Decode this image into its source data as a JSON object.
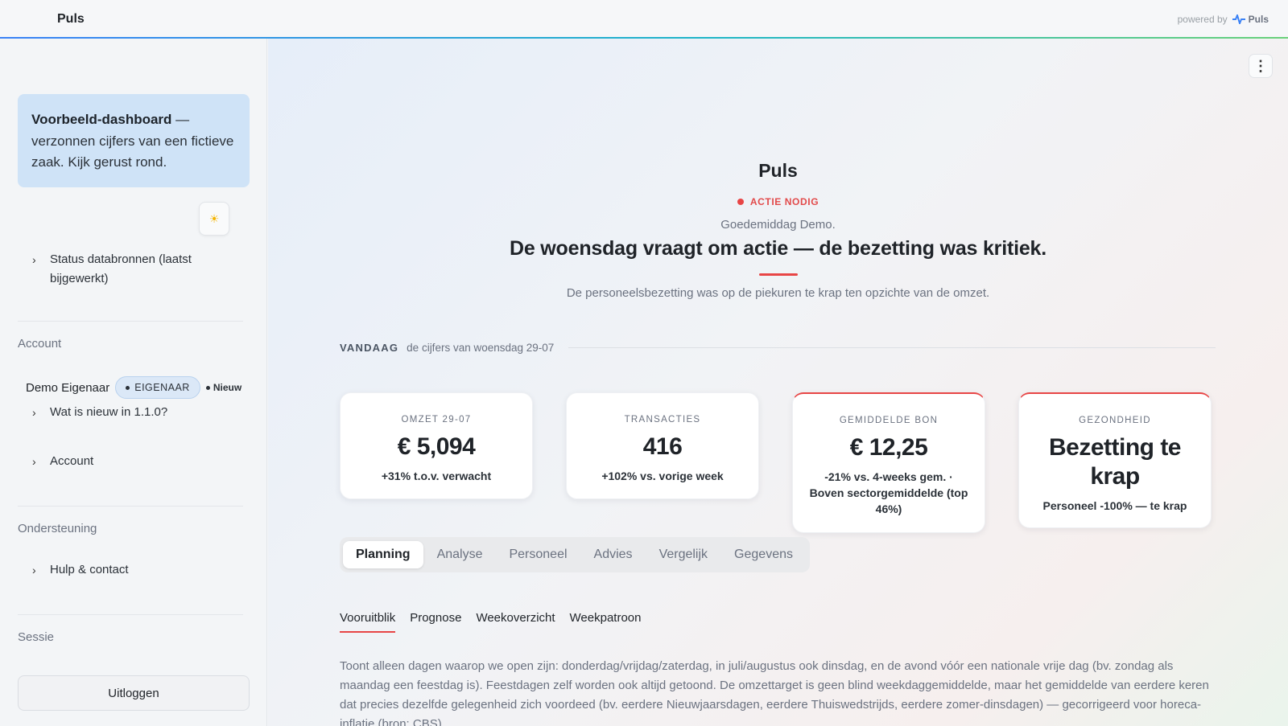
{
  "topbar": {
    "title": "Puls",
    "powered_by": "powered by",
    "brand": "Puls"
  },
  "sidebar": {
    "notice_bold": "Voorbeeld-dashboard",
    "notice_rest": " — verzonnen cijfers van een fictieve zaak. Kijk gerust rond.",
    "theme_icon": "sun-icon",
    "status_item": "Status databronnen (laatst bijgewerkt)",
    "account_section": "Account",
    "user_name": "Demo Eigenaar",
    "role_badge": "EIGENAAR",
    "new_tag": "Nieuw",
    "whats_new": "Wat is nieuw in 1.1.0?",
    "account_item": "Account",
    "support_section": "Ondersteuning",
    "help_item": "Hulp & contact",
    "session_section": "Sessie",
    "logout": "Uitloggen"
  },
  "main": {
    "title": "Puls",
    "status": "ACTIE NODIG",
    "status_color": "#e84545",
    "greeting": "Goedemiddag Demo.",
    "headline": "De woensdag vraagt om actie — de bezetting was kritiek.",
    "subline": "De personeelsbezetting was op de piekuren te krap ten opzichte van de omzet.",
    "today_label": "VANDAAG",
    "today_sub": "de cijfers van woensdag 29-07",
    "kpis": [
      {
        "label": "OMZET 29-07",
        "value": "€ 5,094",
        "note": "+31% t.o.v. verwacht"
      },
      {
        "label": "TRANSACTIES",
        "value": "416",
        "note": "+102% vs. vorige week"
      },
      {
        "label": "GEMIDDELDE BON",
        "value": "€ 12,25",
        "note": "-21% vs. 4-weeks gem. · Boven sectorgemiddelde (top 46%)"
      },
      {
        "label": "GEZONDHEID",
        "value": "Bezetting te krap",
        "note": "Personeel -100% — te krap"
      }
    ],
    "tabs": [
      "Planning",
      "Analyse",
      "Personeel",
      "Advies",
      "Vergelijk",
      "Gegevens"
    ],
    "subtabs": [
      "Vooruitblik",
      "Prognose",
      "Weekoverzicht",
      "Weekpatroon"
    ],
    "info": "Toont alleen dagen waarop we open zijn: donderdag/vrijdag/zaterdag, in juli/augustus ook dinsdag, en de avond vóór een nationale vrije dag (bv. zondag als maandag een feestdag is). Feestdagen zelf worden ook altijd getoond. De omzettarget is geen blind weekdaggemiddelde, maar het gemiddelde van eerdere keren dat precies dezelfde gelegenheid zich voordeed (bv. eerdere Nieuwjaarsdagen, eerdere Thuiswedstrijds, eerdere zomer-dinsdagen) — gecorrigeerd voor horeca-inflatie (bron: CBS)."
  }
}
